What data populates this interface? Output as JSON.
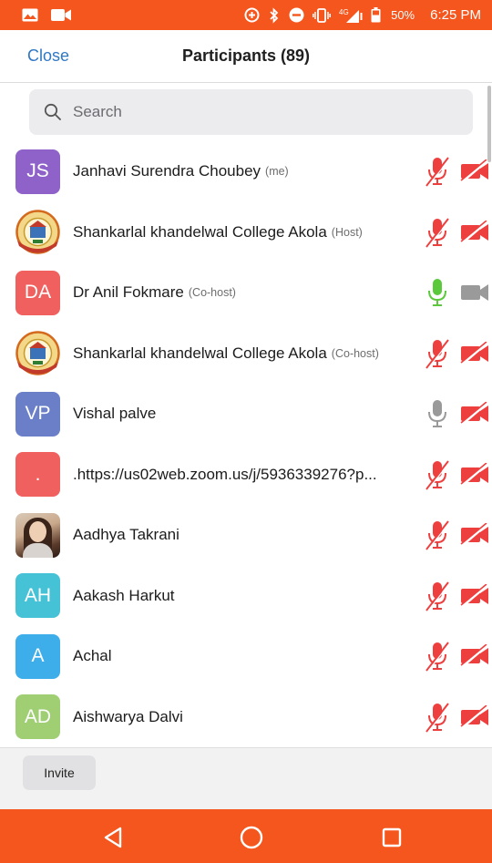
{
  "status_bar": {
    "network": "4G",
    "battery": "50%",
    "time": "6:25 PM"
  },
  "header": {
    "close_label": "Close",
    "title": "Participants (89)"
  },
  "search": {
    "placeholder": "Search"
  },
  "participants": [
    {
      "initials": "JS",
      "name": "Janhavi Surendra Choubey",
      "role": "(me)",
      "avatar_color": "#8e62c9",
      "mic": "muted",
      "video": "off"
    },
    {
      "initials": "",
      "name": "Shankarlal khandelwal College Akola",
      "role": "(Host)",
      "avatar_type": "logo",
      "mic": "muted",
      "video": "off"
    },
    {
      "initials": "DA",
      "name": "Dr Anil Fokmare",
      "role": "(Co-host)",
      "avatar_color": "#f0605e",
      "mic": "on",
      "video": "on"
    },
    {
      "initials": "",
      "name": "Shankarlal khandelwal College Akola",
      "role": "(Co-host)",
      "avatar_type": "logo",
      "mic": "muted",
      "video": "off"
    },
    {
      "initials": "VP",
      "name": "Vishal palve",
      "role": "",
      "avatar_color": "#6a7fc8",
      "mic": "idle",
      "video": "off"
    },
    {
      "initials": ".",
      "name": ".https://us02web.zoom.us/j/5936339276?p...",
      "role": "",
      "avatar_color": "#f0605e",
      "mic": "muted",
      "video": "off"
    },
    {
      "initials": "",
      "name": "Aadhya Takrani",
      "role": "",
      "avatar_type": "photo",
      "mic": "muted",
      "video": "off"
    },
    {
      "initials": "AH",
      "name": "Aakash Harkut",
      "role": "",
      "avatar_color": "#46c2d6",
      "mic": "muted",
      "video": "off"
    },
    {
      "initials": "A",
      "name": "Achal",
      "role": "",
      "avatar_color": "#3daeea",
      "mic": "muted",
      "video": "off"
    },
    {
      "initials": "AD",
      "name": "Aishwarya Dalvi",
      "role": "",
      "avatar_color": "#9fce73",
      "mic": "muted",
      "video": "off"
    }
  ],
  "footer": {
    "invite_label": "Invite"
  },
  "colors": {
    "accent_orange": "#f4561d",
    "link_blue": "#2f78c4",
    "muted_red": "#ee3f3f",
    "mic_on_green": "#5cc93c",
    "icon_gray": "#9a9a9a"
  },
  "icons": {
    "status_left": [
      "gallery-icon",
      "video-camera-icon"
    ],
    "status_right": [
      "data-saver-icon",
      "bluetooth-icon",
      "do-not-disturb-icon",
      "vibrate-icon",
      "signal-icon",
      "battery-icon"
    ],
    "search": "search-icon",
    "nav": [
      "back-icon",
      "home-icon",
      "recents-icon"
    ]
  }
}
